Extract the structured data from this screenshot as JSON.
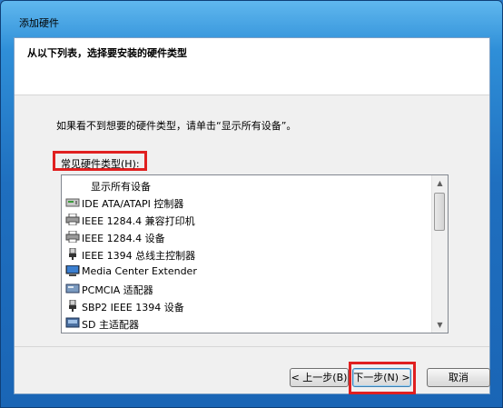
{
  "window": {
    "title": "添加硬件"
  },
  "header": {
    "text": "从以下列表，选择要安装的硬件类型"
  },
  "instruction": "如果看不到想要的硬件类型，请单击“显示所有设备”。",
  "list": {
    "label": "常见硬件类型(H):",
    "items": [
      {
        "label": "显示所有设备",
        "icon": ""
      },
      {
        "label": "IDE ATA/ATAPI 控制器",
        "icon": "ide-controller-icon"
      },
      {
        "label": "IEEE 1284.4 兼容打印机",
        "icon": "printer-icon"
      },
      {
        "label": "IEEE 1284.4 设备",
        "icon": "printer-icon"
      },
      {
        "label": "IEEE 1394 总线主控制器",
        "icon": "usb-plug-icon"
      },
      {
        "label": "Media Center Extender",
        "icon": "monitor-icon"
      },
      {
        "label": "PCMCIA 适配器",
        "icon": "pcmcia-card-icon"
      },
      {
        "label": "SBP2 IEEE 1394 设备",
        "icon": "usb-plug-icon"
      },
      {
        "label": "SD 主适配器",
        "icon": "sd-adapter-icon"
      }
    ]
  },
  "buttons": {
    "back": "< 上一步(B)",
    "next": "下一步(N) >",
    "cancel": "取消"
  }
}
